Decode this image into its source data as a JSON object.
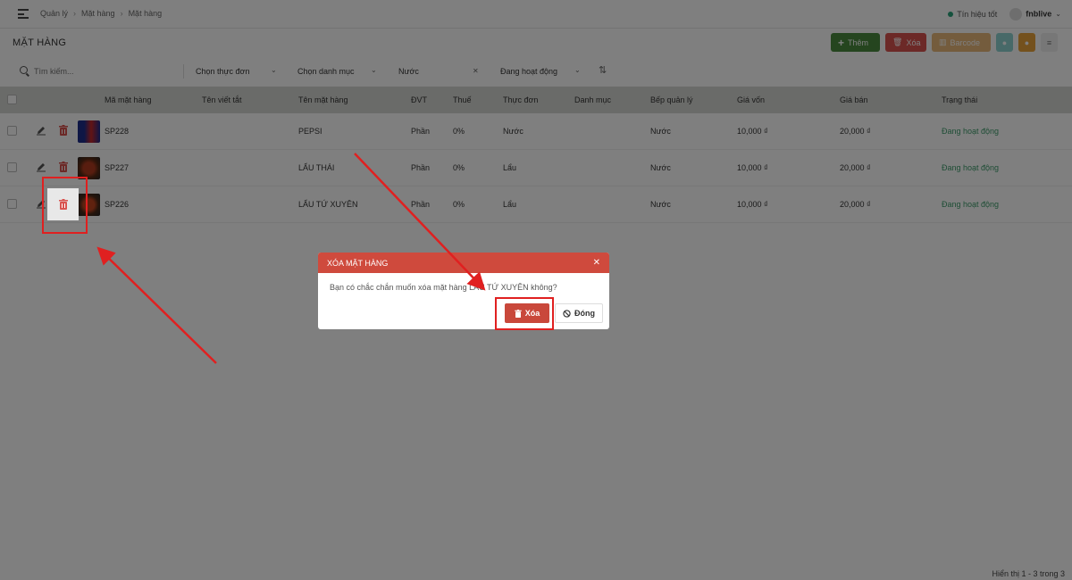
{
  "breadcrumb": [
    "Quản lý",
    "Mặt hàng",
    "Mặt hàng"
  ],
  "topbar": {
    "status": "Tín hiệu tốt",
    "user": "fnblive"
  },
  "page_title": "MẶT HÀNG",
  "toolbar": {
    "add": "Thêm",
    "delete": "Xóa",
    "barcode": "Barcode"
  },
  "filters": {
    "search_placeholder": "Tìm kiếm...",
    "menu": "Chọn thực đơn",
    "category": "Chọn danh mục",
    "kitchen": "Nước",
    "status": "Đang hoạt động"
  },
  "columns": [
    "Mã mặt hàng",
    "Tên viết tắt",
    "Tên mặt hàng",
    "ĐVT",
    "Thuế",
    "Thực đơn",
    "Danh mục",
    "Bếp quản lý",
    "Giá vốn",
    "Giá bán",
    "Trạng thái"
  ],
  "rows": [
    {
      "code": "SP228",
      "abbr": "",
      "name": "PEPSI",
      "unit": "Phần",
      "tax": "0%",
      "menu": "Nước",
      "category": "",
      "kitchen": "Nước",
      "cost": "10,000 ₫",
      "price": "20,000 ₫",
      "status": "Đang hoạt động"
    },
    {
      "code": "SP227",
      "abbr": "",
      "name": "LẨU THÁI",
      "unit": "Phần",
      "tax": "0%",
      "menu": "Lẩu",
      "category": "",
      "kitchen": "Nước",
      "cost": "10,000 ₫",
      "price": "20,000 ₫",
      "status": "Đang hoạt động"
    },
    {
      "code": "SP226",
      "abbr": "",
      "name": "LẨU TỨ XUYÊN",
      "unit": "Phần",
      "tax": "0%",
      "menu": "Lẩu",
      "category": "",
      "kitchen": "Nước",
      "cost": "10,000 ₫",
      "price": "20,000 ₫",
      "status": "Đang hoạt động"
    }
  ],
  "footer": "Hiển thị 1 - 3 trong 3",
  "modal": {
    "title": "XÓA MẶT HÀNG",
    "message": "Bạn có chắc chắn muốn xóa mặt hàng LẨU TỨ XUYÊN không?",
    "delete": "Xóa",
    "close": "Đóng"
  },
  "colors": {
    "accent_red": "#cf4a3d",
    "green": "#4a8a3f",
    "annotation": "#e02020"
  }
}
